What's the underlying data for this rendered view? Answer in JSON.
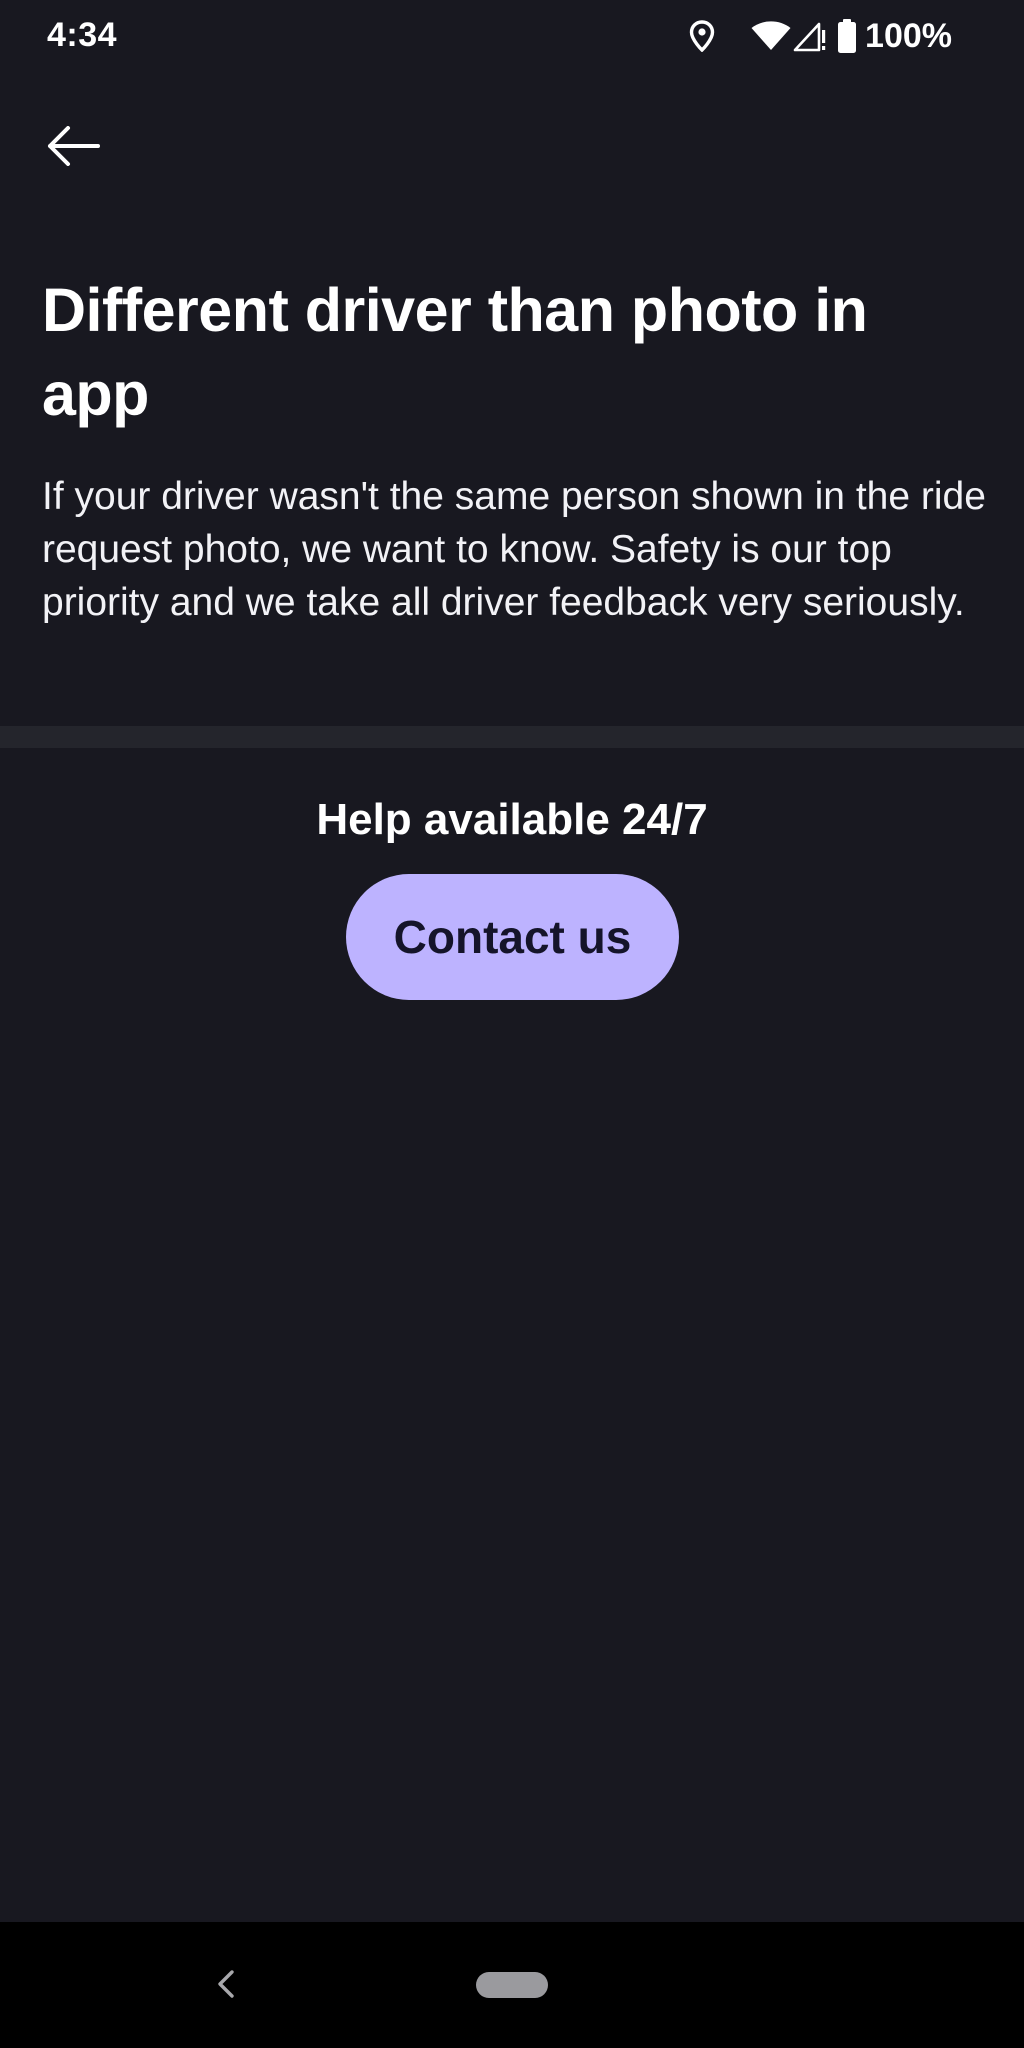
{
  "status_bar": {
    "time": "4:34",
    "battery_text": "100%",
    "icons": [
      "location-icon",
      "wifi-icon",
      "signal-icon",
      "battery-icon"
    ]
  },
  "header": {
    "back_icon": "arrow-left-icon"
  },
  "content": {
    "title": "Different driver than photo in app",
    "description": "If your driver wasn't the same person shown in the ride request photo, we want to know. Safety is our top priority and we take all driver feedback very seriously."
  },
  "help": {
    "heading": "Help available 24/7",
    "contact_label": "Contact us"
  },
  "nav_bar": {
    "icons": [
      "nav-back-icon",
      "home-pill-icon"
    ]
  },
  "colors": {
    "background": "#181820",
    "divider": "#24252c",
    "accent_button": "#bdb3ff",
    "accent_button_text": "#15142a",
    "nav_bar": "#000000"
  }
}
